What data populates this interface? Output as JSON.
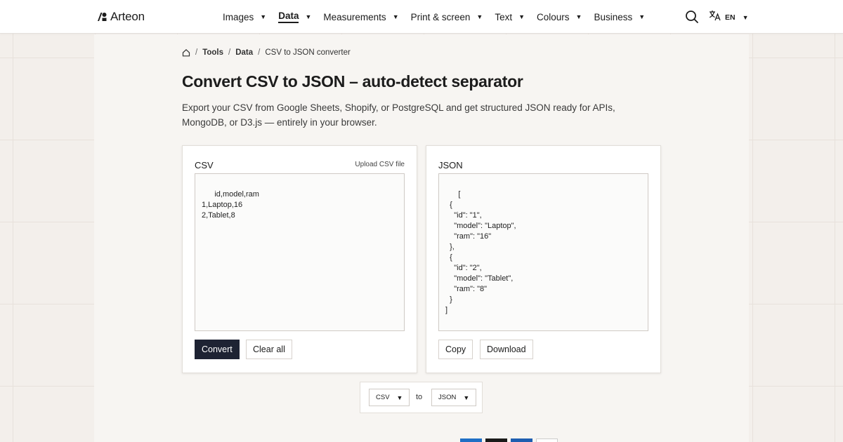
{
  "header": {
    "logo_text": "Arteon",
    "nav": [
      {
        "label": "Images",
        "active": false
      },
      {
        "label": "Data",
        "active": true
      },
      {
        "label": "Measurements",
        "active": false
      },
      {
        "label": "Print & screen",
        "active": false
      },
      {
        "label": "Text",
        "active": false
      },
      {
        "label": "Colours",
        "active": false
      },
      {
        "label": "Business",
        "active": false
      }
    ],
    "caret": "▼",
    "lang_code": "EN",
    "search_icon": "search-icon",
    "translate_icon": "translate-icon"
  },
  "breadcrumb": {
    "sep": "/",
    "items": [
      "Tools",
      "Data",
      "CSV to JSON converter"
    ]
  },
  "page": {
    "title": "Convert CSV to JSON – auto-detect separator",
    "intro": "Export your CSV from Google Sheets, Shopify, or PostgreSQL and get structured JSON ready for APIs, MongoDB, or D3.js — entirely in your browser."
  },
  "csv_card": {
    "title": "CSV",
    "upload_label": "Upload CSV file",
    "input_value": "id,model,ram\n1,Laptop,16\n2,Tablet,8",
    "convert_label": "Convert",
    "clear_label": "Clear all"
  },
  "json_card": {
    "title": "JSON",
    "output_value": "[\n  {\n    \"id\": \"1\",\n    \"model\": \"Laptop\",\n    \"ram\": \"16\"\n  },\n  {\n    \"id\": \"2\",\n    \"model\": \"Tablet\",\n    \"ram\": \"8\"\n  }\n]",
    "copy_label": "Copy",
    "download_label": "Download"
  },
  "converter": {
    "from": "CSV",
    "to_label": "to",
    "to": "JSON"
  },
  "colors": {
    "primary_button": "#1e2333",
    "page_background": "#f3efeb",
    "panel_background": "#f7f5f2",
    "swatches": [
      "#1f6fc5",
      "#1a1a1a",
      "#1e5eb0",
      "#ffffff"
    ]
  }
}
